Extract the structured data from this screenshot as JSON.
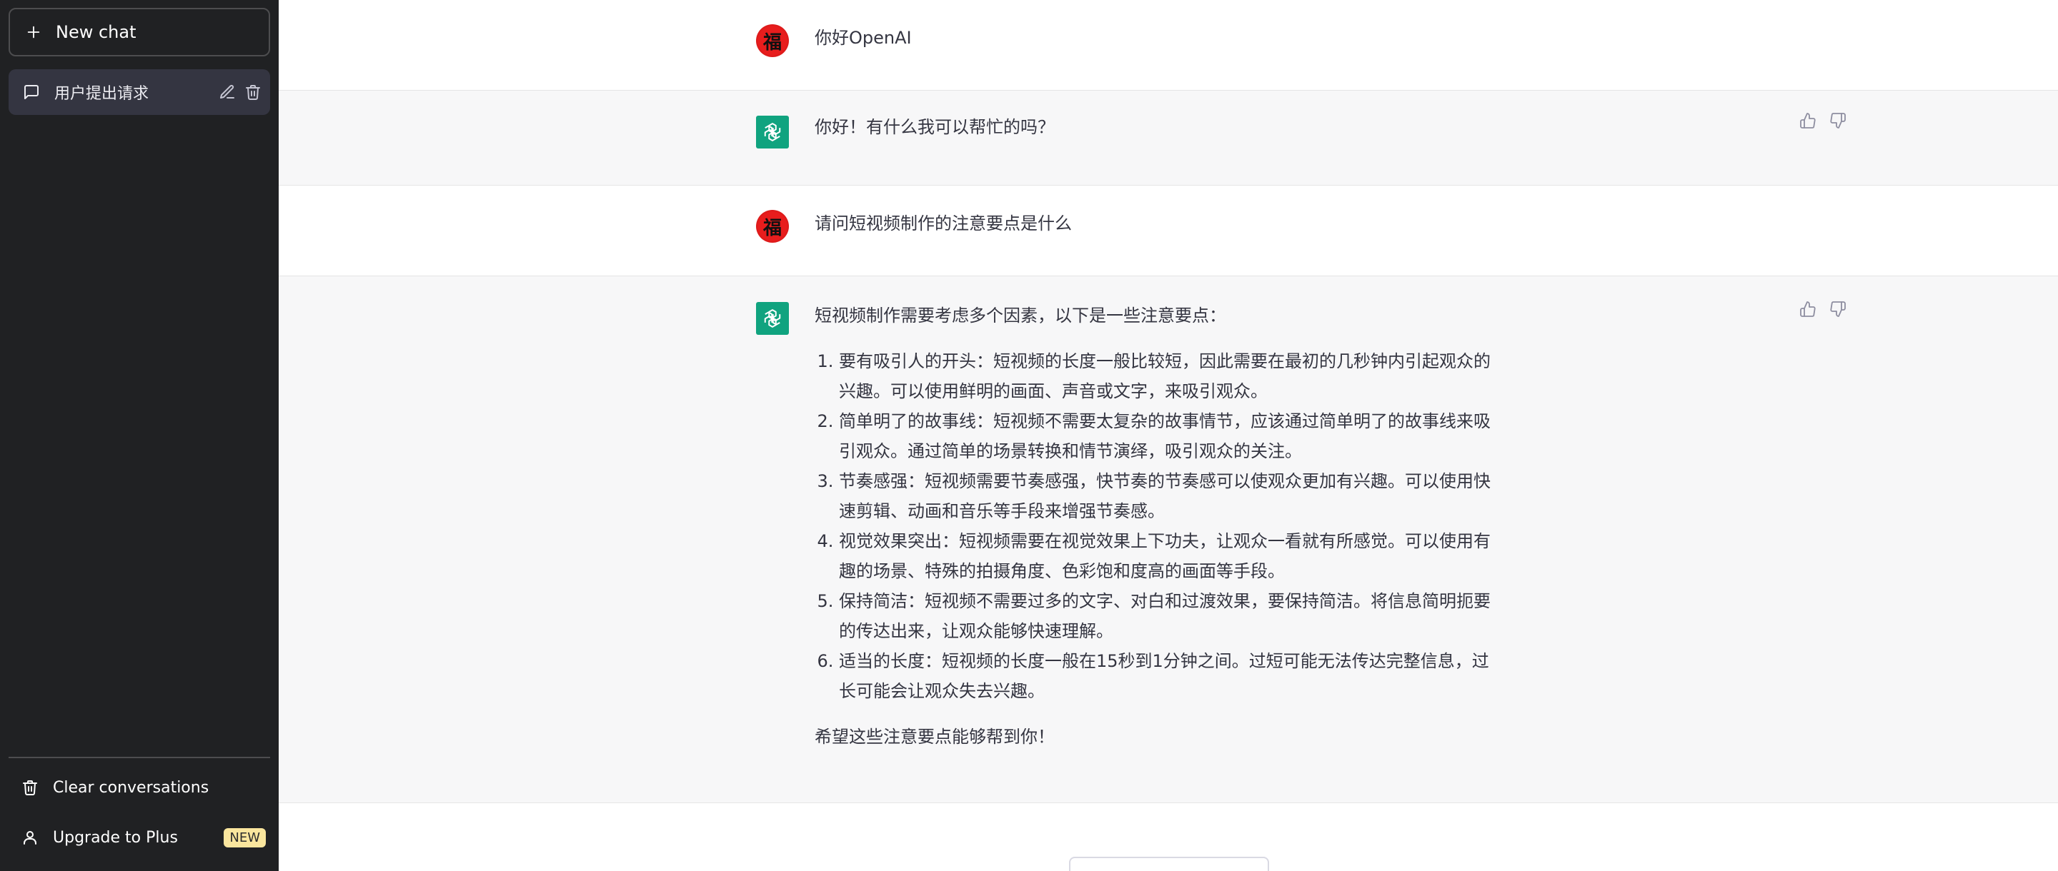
{
  "sidebar": {
    "new_chat_label": "New chat",
    "conversations": [
      {
        "label": "用户提出请求"
      }
    ],
    "clear_label": "Clear conversations",
    "upgrade_label": "Upgrade to Plus",
    "upgrade_badge": "NEW"
  },
  "messages": [
    {
      "role": "user",
      "text": "你好OpenAI"
    },
    {
      "role": "assistant",
      "text": "你好！有什么我可以帮忙的吗？"
    },
    {
      "role": "user",
      "text": "请问短视频制作的注意要点是什么"
    },
    {
      "role": "assistant",
      "intro": "短视频制作需要考虑多个因素，以下是一些注意要点：",
      "items": [
        "要有吸引人的开头：短视频的长度一般比较短，因此需要在最初的几秒钟内引起观众的兴趣。可以使用鲜明的画面、声音或文字，来吸引观众。",
        "简单明了的故事线：短视频不需要太复杂的故事情节，应该通过简单明了的故事线来吸引观众。通过简单的场景转换和情节演绎，吸引观众的关注。",
        "节奏感强：短视频需要节奏感强，快节奏的节奏感可以使观众更加有兴趣。可以使用快速剪辑、动画和音乐等手段来增强节奏感。",
        "视觉效果突出：短视频需要在视觉效果上下功夫，让观众一看就有所感觉。可以使用有趣的场景、特殊的拍摄角度、色彩饱和度高的画面等手段。",
        "保持简洁：短视频不需要过多的文字、对白和过渡效果，要保持简洁。将信息简明扼要的传达出来，让观众能够快速理解。",
        "适当的长度：短视频的长度一般在15秒到1分钟之间。过短可能无法传达完整信息，过长可能会让观众失去兴趣。"
      ],
      "outro": "希望这些注意要点能够帮到你！"
    }
  ],
  "user_avatar_glyph": "福",
  "colors": {
    "sidebar_bg": "#202123",
    "assistant_bg": "#f7f7f8",
    "brand_green": "#10a37f",
    "badge_yellow": "#fae69e"
  }
}
